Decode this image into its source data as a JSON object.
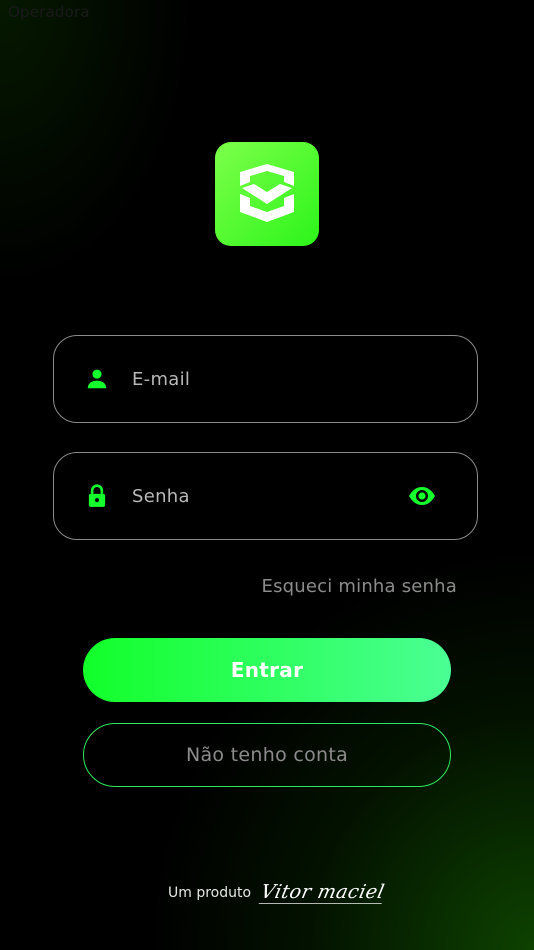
{
  "status_bar": {
    "carrier": "Operadora"
  },
  "logo": {
    "icon": "shield-chevron-icon",
    "background_color": "#5cff2e"
  },
  "form": {
    "email": {
      "placeholder": "E-mail",
      "value": "",
      "icon": "person-icon"
    },
    "password": {
      "placeholder": "Senha",
      "value": "",
      "icon": "lock-icon",
      "toggle_icon": "eye-icon"
    },
    "forgot_password_label": "Esqueci minha senha"
  },
  "actions": {
    "login_label": "Entrar",
    "signup_label": "Não tenho conta"
  },
  "footer": {
    "prefix": "Um produto",
    "brand_signature": "Vitor maciel"
  },
  "colors": {
    "accent": "#14ff2c",
    "accent_end": "#4aff94",
    "background": "#000000",
    "muted_text": "#8c8c8c"
  }
}
